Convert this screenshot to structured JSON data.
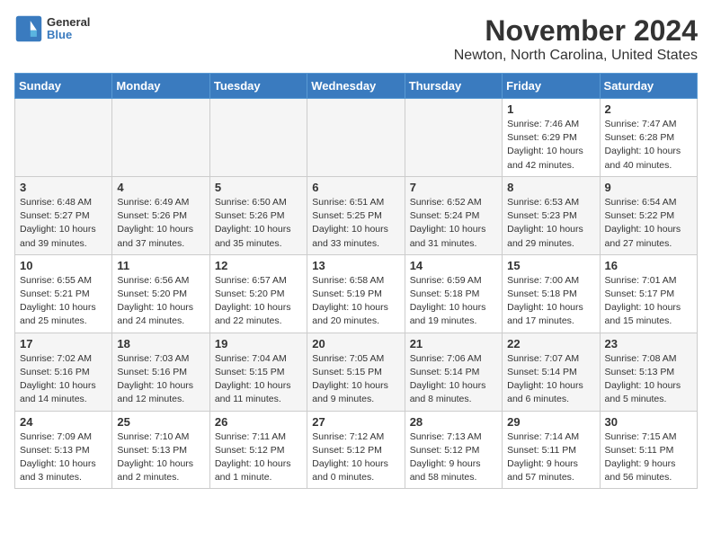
{
  "app": {
    "logo_line1": "General",
    "logo_line2": "Blue"
  },
  "header": {
    "title": "November 2024",
    "subtitle": "Newton, North Carolina, United States"
  },
  "days_of_week": [
    "Sunday",
    "Monday",
    "Tuesday",
    "Wednesday",
    "Thursday",
    "Friday",
    "Saturday"
  ],
  "weeks": [
    {
      "days": [
        {
          "num": "",
          "info": ""
        },
        {
          "num": "",
          "info": ""
        },
        {
          "num": "",
          "info": ""
        },
        {
          "num": "",
          "info": ""
        },
        {
          "num": "",
          "info": ""
        },
        {
          "num": "1",
          "info": "Sunrise: 7:46 AM\nSunset: 6:29 PM\nDaylight: 10 hours\nand 42 minutes."
        },
        {
          "num": "2",
          "info": "Sunrise: 7:47 AM\nSunset: 6:28 PM\nDaylight: 10 hours\nand 40 minutes."
        }
      ]
    },
    {
      "days": [
        {
          "num": "3",
          "info": "Sunrise: 6:48 AM\nSunset: 5:27 PM\nDaylight: 10 hours\nand 39 minutes."
        },
        {
          "num": "4",
          "info": "Sunrise: 6:49 AM\nSunset: 5:26 PM\nDaylight: 10 hours\nand 37 minutes."
        },
        {
          "num": "5",
          "info": "Sunrise: 6:50 AM\nSunset: 5:26 PM\nDaylight: 10 hours\nand 35 minutes."
        },
        {
          "num": "6",
          "info": "Sunrise: 6:51 AM\nSunset: 5:25 PM\nDaylight: 10 hours\nand 33 minutes."
        },
        {
          "num": "7",
          "info": "Sunrise: 6:52 AM\nSunset: 5:24 PM\nDaylight: 10 hours\nand 31 minutes."
        },
        {
          "num": "8",
          "info": "Sunrise: 6:53 AM\nSunset: 5:23 PM\nDaylight: 10 hours\nand 29 minutes."
        },
        {
          "num": "9",
          "info": "Sunrise: 6:54 AM\nSunset: 5:22 PM\nDaylight: 10 hours\nand 27 minutes."
        }
      ]
    },
    {
      "days": [
        {
          "num": "10",
          "info": "Sunrise: 6:55 AM\nSunset: 5:21 PM\nDaylight: 10 hours\nand 25 minutes."
        },
        {
          "num": "11",
          "info": "Sunrise: 6:56 AM\nSunset: 5:20 PM\nDaylight: 10 hours\nand 24 minutes."
        },
        {
          "num": "12",
          "info": "Sunrise: 6:57 AM\nSunset: 5:20 PM\nDaylight: 10 hours\nand 22 minutes."
        },
        {
          "num": "13",
          "info": "Sunrise: 6:58 AM\nSunset: 5:19 PM\nDaylight: 10 hours\nand 20 minutes."
        },
        {
          "num": "14",
          "info": "Sunrise: 6:59 AM\nSunset: 5:18 PM\nDaylight: 10 hours\nand 19 minutes."
        },
        {
          "num": "15",
          "info": "Sunrise: 7:00 AM\nSunset: 5:18 PM\nDaylight: 10 hours\nand 17 minutes."
        },
        {
          "num": "16",
          "info": "Sunrise: 7:01 AM\nSunset: 5:17 PM\nDaylight: 10 hours\nand 15 minutes."
        }
      ]
    },
    {
      "days": [
        {
          "num": "17",
          "info": "Sunrise: 7:02 AM\nSunset: 5:16 PM\nDaylight: 10 hours\nand 14 minutes."
        },
        {
          "num": "18",
          "info": "Sunrise: 7:03 AM\nSunset: 5:16 PM\nDaylight: 10 hours\nand 12 minutes."
        },
        {
          "num": "19",
          "info": "Sunrise: 7:04 AM\nSunset: 5:15 PM\nDaylight: 10 hours\nand 11 minutes."
        },
        {
          "num": "20",
          "info": "Sunrise: 7:05 AM\nSunset: 5:15 PM\nDaylight: 10 hours\nand 9 minutes."
        },
        {
          "num": "21",
          "info": "Sunrise: 7:06 AM\nSunset: 5:14 PM\nDaylight: 10 hours\nand 8 minutes."
        },
        {
          "num": "22",
          "info": "Sunrise: 7:07 AM\nSunset: 5:14 PM\nDaylight: 10 hours\nand 6 minutes."
        },
        {
          "num": "23",
          "info": "Sunrise: 7:08 AM\nSunset: 5:13 PM\nDaylight: 10 hours\nand 5 minutes."
        }
      ]
    },
    {
      "days": [
        {
          "num": "24",
          "info": "Sunrise: 7:09 AM\nSunset: 5:13 PM\nDaylight: 10 hours\nand 3 minutes."
        },
        {
          "num": "25",
          "info": "Sunrise: 7:10 AM\nSunset: 5:13 PM\nDaylight: 10 hours\nand 2 minutes."
        },
        {
          "num": "26",
          "info": "Sunrise: 7:11 AM\nSunset: 5:12 PM\nDaylight: 10 hours\nand 1 minute."
        },
        {
          "num": "27",
          "info": "Sunrise: 7:12 AM\nSunset: 5:12 PM\nDaylight: 10 hours\nand 0 minutes."
        },
        {
          "num": "28",
          "info": "Sunrise: 7:13 AM\nSunset: 5:12 PM\nDaylight: 9 hours\nand 58 minutes."
        },
        {
          "num": "29",
          "info": "Sunrise: 7:14 AM\nSunset: 5:11 PM\nDaylight: 9 hours\nand 57 minutes."
        },
        {
          "num": "30",
          "info": "Sunrise: 7:15 AM\nSunset: 5:11 PM\nDaylight: 9 hours\nand 56 minutes."
        }
      ]
    }
  ]
}
